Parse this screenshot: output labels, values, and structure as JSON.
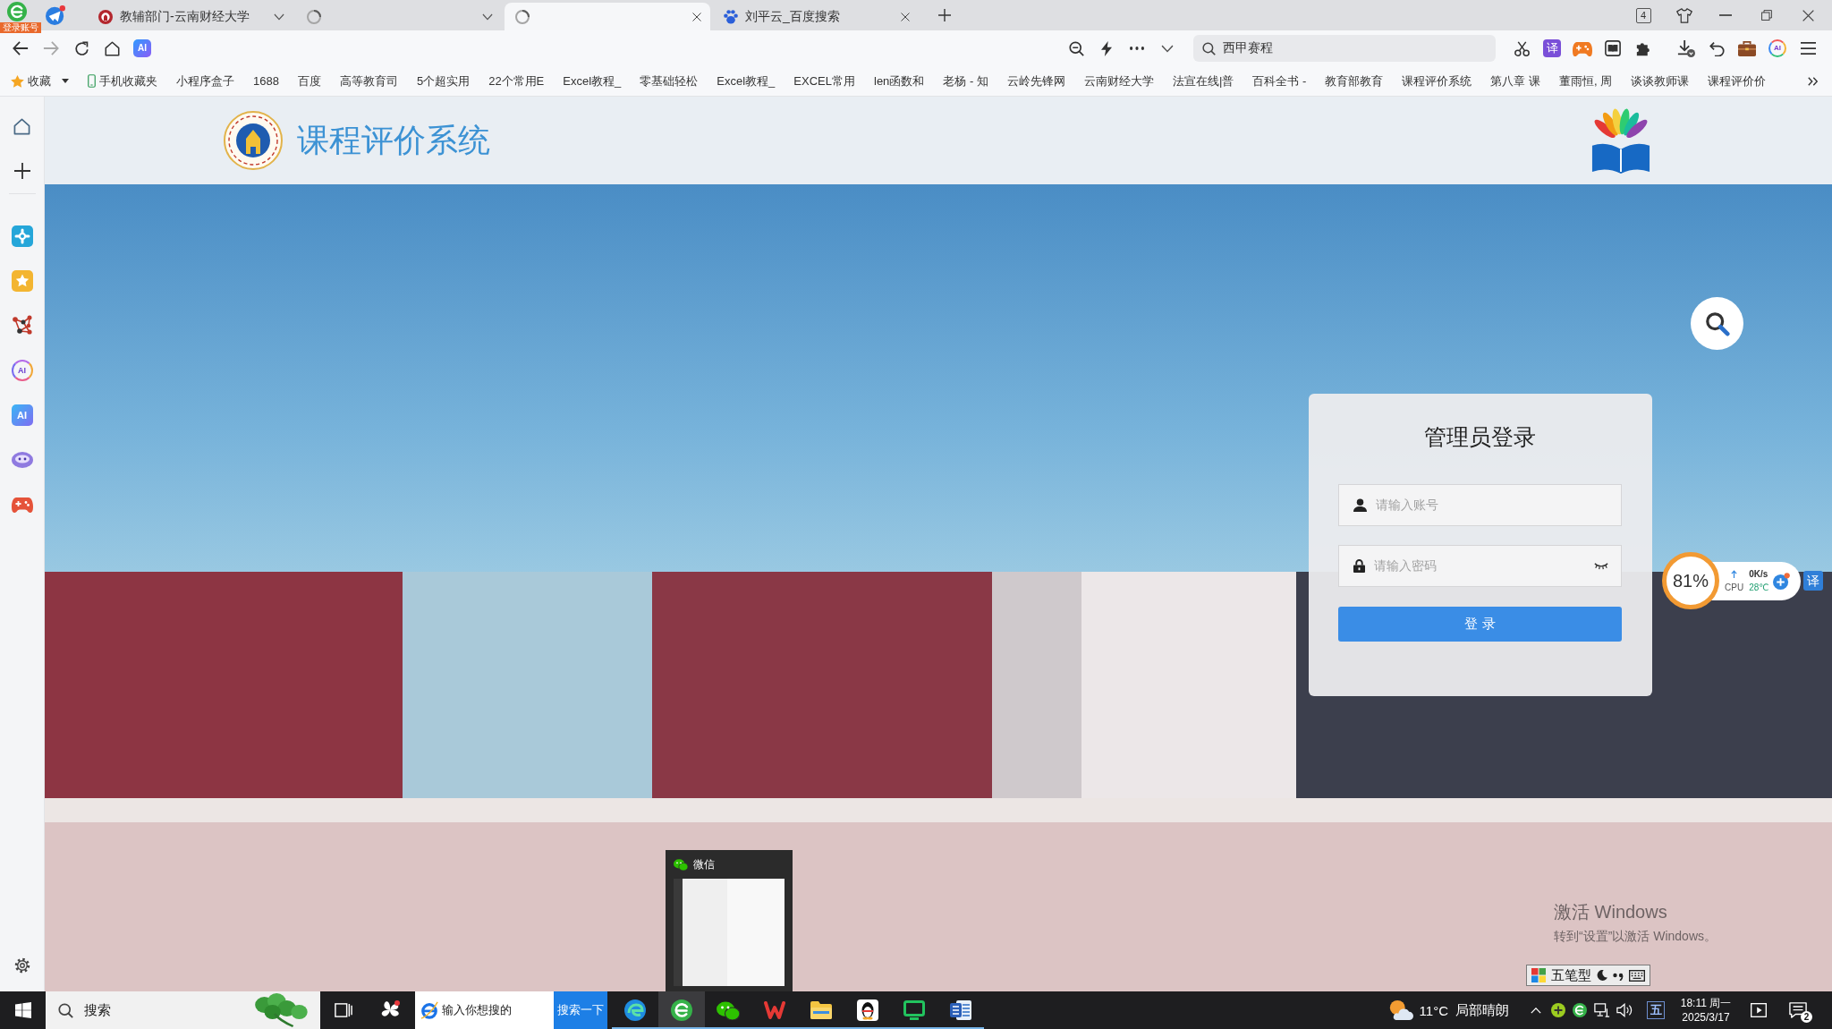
{
  "tabbar": {
    "login_badge": "登录账号",
    "tabs": [
      {
        "title": "教辅部门-云南财经大学",
        "kind": "group",
        "selected": false
      },
      {
        "kind": "group",
        "selected": false
      },
      {
        "kind": "page",
        "selected": true
      },
      {
        "title": "刘平云_百度搜索",
        "kind": "page",
        "selected": false
      }
    ],
    "tab_count": "4"
  },
  "toolbar": {
    "back": {
      "disabled": false
    },
    "forward": {
      "disabled": true
    },
    "ai_badge": "AI",
    "search": {
      "value": "西甲赛程"
    },
    "translate": "译",
    "assistant_badge": "AI"
  },
  "bookmarks": [
    {
      "title": "收藏",
      "kind": "folder"
    },
    {
      "title": "手机收藏夹",
      "kind": "mobile"
    },
    {
      "title": "小程序盒子",
      "kind": "link"
    },
    {
      "title": "1688",
      "kind": "link"
    },
    {
      "title": "百度",
      "kind": "link"
    },
    {
      "title": "高等教育司",
      "kind": "link"
    },
    {
      "title": "5个超实用",
      "kind": "link"
    },
    {
      "title": "22个常用E",
      "kind": "link"
    },
    {
      "title": "Excel教程_",
      "kind": "link"
    },
    {
      "title": "零基础轻松",
      "kind": "link"
    },
    {
      "title": "Excel教程_",
      "kind": "link"
    },
    {
      "title": "EXCEL常用",
      "kind": "link"
    },
    {
      "title": "len函数和",
      "kind": "link"
    },
    {
      "title": "老杨 - 知",
      "kind": "link"
    },
    {
      "title": "云岭先锋网",
      "kind": "link"
    },
    {
      "title": "云南财经大学",
      "kind": "link"
    },
    {
      "title": "法宣在线|普",
      "kind": "link"
    },
    {
      "title": "百科全书 -",
      "kind": "link"
    },
    {
      "title": "教育部教育",
      "kind": "link"
    },
    {
      "title": "课程评价系统",
      "kind": "link"
    },
    {
      "title": "第八章 课",
      "kind": "link"
    },
    {
      "title": "董雨恒, 周",
      "kind": "link"
    },
    {
      "title": "谈谈教师课",
      "kind": "link"
    },
    {
      "title": "课程评价价",
      "kind": "link"
    }
  ],
  "sidebar": {
    "ai_ring": "AI",
    "ai_tile": "AI"
  },
  "page": {
    "site_title": "课程评价系统",
    "login": {
      "title": "管理员登录",
      "username": {
        "placeholder": "请输入账号"
      },
      "password": {
        "placeholder": "请输入密码"
      },
      "submit": "登 录"
    }
  },
  "monitor": {
    "usage": "81%",
    "speed": "0K/s",
    "cpu_label": "CPU",
    "cpu_temp": "28℃",
    "translate": "译"
  },
  "wechat_preview": {
    "title": "微信"
  },
  "ime_bar": {
    "mode": "五笔型"
  },
  "activation": {
    "title": "激活 Windows",
    "hint": "转到“设置”以激活 Windows。"
  },
  "taskbar": {
    "search": {
      "placeholder": "搜索"
    },
    "web_search": {
      "placeholder": "输入你想搜的",
      "button": "搜索一下"
    },
    "apps": [
      {
        "kind": "swirl",
        "running": true,
        "selected": false
      },
      {
        "kind": "browser",
        "running": true,
        "selected": true
      },
      {
        "kind": "chat",
        "running": true,
        "selected": false
      },
      {
        "kind": "zigzag",
        "running": true,
        "selected": false
      },
      {
        "kind": "folder",
        "running": true,
        "selected": false
      },
      {
        "kind": "penguin",
        "running": true,
        "selected": false
      },
      {
        "kind": "monitor",
        "running": true,
        "selected": false
      },
      {
        "kind": "document",
        "running": true,
        "selected": false
      }
    ],
    "tray": {
      "temperature": "11°C",
      "condition": "局部晴朗",
      "ime": "五",
      "time": "18:11 周一",
      "date": "2025/3/17",
      "notifications": "2"
    }
  }
}
